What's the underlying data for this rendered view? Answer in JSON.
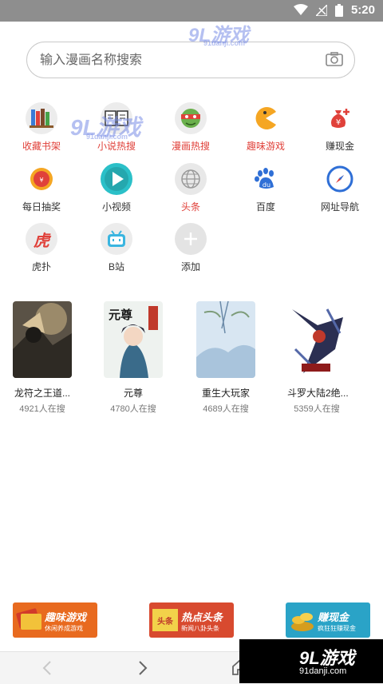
{
  "status_bar": {
    "time": "5:20",
    "icons": [
      "wifi-icon",
      "no-signal-icon",
      "battery-icon"
    ]
  },
  "search": {
    "placeholder": "输入漫画名称搜索",
    "icon": "camera-icon"
  },
  "shortcuts": [
    {
      "label": "收藏书架",
      "icon": "bookshelf-icon",
      "color": "#e0413a"
    },
    {
      "label": "小说热搜",
      "icon": "book-open-icon",
      "color": "#e0413a"
    },
    {
      "label": "漫画热搜",
      "icon": "turtle-icon",
      "color": "#e0413a"
    },
    {
      "label": "趣味游戏",
      "icon": "pacman-icon",
      "color": "#e0413a"
    },
    {
      "label": "赚现金",
      "icon": "money-bag-icon",
      "color": "#333333"
    },
    {
      "label": "每日抽奖",
      "icon": "lottery-icon",
      "color": "#333333"
    },
    {
      "label": "小视频",
      "icon": "play-icon",
      "color": "#333333"
    },
    {
      "label": "头条",
      "icon": "globe-icon",
      "color": "#e0413a"
    },
    {
      "label": "百度",
      "icon": "baidu-paw-icon",
      "color": "#333333"
    },
    {
      "label": "网址导航",
      "icon": "compass-icon",
      "color": "#333333"
    },
    {
      "label": "虎扑",
      "icon": "hupu-icon",
      "color": "#333333"
    },
    {
      "label": "B站",
      "icon": "bilibili-icon",
      "color": "#333333"
    },
    {
      "label": "添加",
      "icon": "plus-icon",
      "color": "#333333"
    }
  ],
  "books": [
    {
      "title": "龙符之王道...",
      "count": "4921人在搜"
    },
    {
      "title": "元尊",
      "count": "4780人在搜",
      "cover_text": "元尊"
    },
    {
      "title": "重生大玩家",
      "count": "4689人在搜"
    },
    {
      "title": "斗罗大陆2绝...",
      "count": "5359人在搜"
    }
  ],
  "banners": [
    {
      "title": "趣味游戏",
      "subtitle": "休闲养成游戏"
    },
    {
      "title": "热点头条",
      "subtitle": "新闻八卦头条",
      "badge": "头条"
    },
    {
      "title": "赚现金",
      "subtitle": "疯狂狂赚现金"
    }
  ],
  "watermark": {
    "brand": "9L游戏",
    "domain": "91danji.com"
  },
  "colors": {
    "accent_red": "#e0413a",
    "status_bar": "#8e8e8e"
  }
}
